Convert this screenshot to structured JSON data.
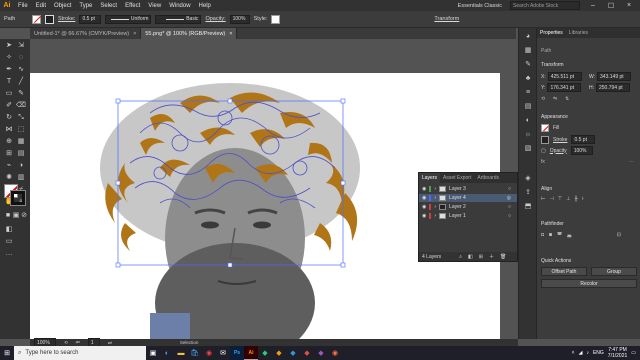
{
  "app": {
    "logo": "Ai"
  },
  "menu": [
    "File",
    "Edit",
    "Object",
    "Type",
    "Select",
    "Effect",
    "View",
    "Window",
    "Help"
  ],
  "workspace": {
    "label": "Essentials Classic",
    "search_placeholder": "Search Adobe Stock"
  },
  "control": {
    "selection": "Path",
    "stroke_label": "Stroke:",
    "stroke_value": "0.5 pt",
    "profile": "Uniform",
    "brush": "Basic",
    "opacity_label": "Opacity:",
    "opacity_value": "100%",
    "style_label": "Style:",
    "transform_label": "Transform"
  },
  "tabs": [
    {
      "label": "Untitled-1* @ 66.67% (CMYK/Preview)",
      "close": "×"
    },
    {
      "label": "55.png* @ 100% (RGB/Preview)",
      "close": "×"
    }
  ],
  "layers_panel": {
    "tabs": [
      "Layers",
      "Asset Export",
      "Artboards"
    ],
    "rows": [
      {
        "name": "Layer 3"
      },
      {
        "name": "Layer 4"
      },
      {
        "name": "Layer 2"
      },
      {
        "name": "Layer 1"
      }
    ],
    "count": "4 Layers"
  },
  "properties": {
    "tabs": [
      "Properties",
      "Libraries"
    ],
    "kind": "Path",
    "transform_title": "Transform",
    "x": "425.511 pt",
    "y": "176.341 pt",
    "w": "343.149 pt",
    "h": "250.794 pt",
    "appearance_title": "Appearance",
    "fill_label": "Fill",
    "stroke_label": "Stroke",
    "stroke_value": "0.5 pt",
    "opacity_label": "Opacity",
    "opacity_value": "100%",
    "align_title": "Align",
    "pathfinder_title": "Pathfinder",
    "quick_title": "Quick Actions",
    "offset_path": "Offset Path",
    "group": "Group",
    "recolor": "Recolor"
  },
  "status": {
    "zoom": "100%",
    "page": "1",
    "tool": "Selection"
  },
  "taskbar": {
    "search_placeholder": "Type here to search",
    "lang": "ENG",
    "time": "7:47 PM",
    "date": "7/1/2021"
  },
  "colors": {
    "accent": "#ff9a00",
    "hair": "#b07516",
    "stroke": "#4b4fc9"
  }
}
